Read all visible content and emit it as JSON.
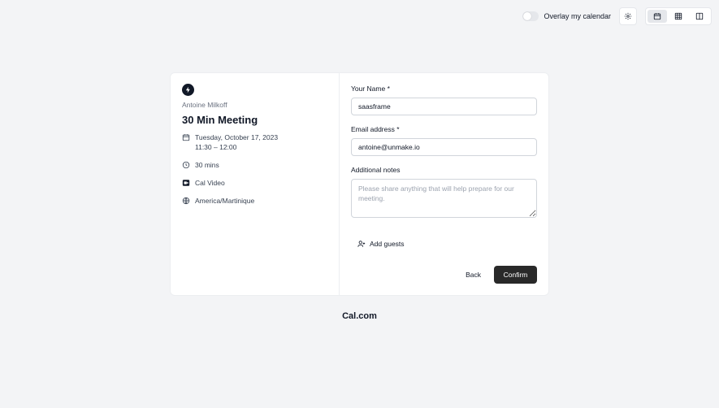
{
  "topbar": {
    "overlay_label": "Overlay my calendar",
    "overlay_on": false,
    "icons": {
      "settings": "gear-icon",
      "month_view": "calendar-icon",
      "week_view": "grid-icon",
      "column_view": "columns-icon"
    }
  },
  "event": {
    "host": "Antoine Milkoff",
    "title": "30 Min Meeting",
    "date": "Tuesday, October 17, 2023",
    "time": "11:30 – 12:00",
    "duration": "30 mins",
    "location": "Cal Video",
    "timezone": "America/Martinique"
  },
  "form": {
    "name_label": "Your Name *",
    "name_value": "saasframe",
    "email_label": "Email address *",
    "email_value": "antoine@unmake.io",
    "notes_label": "Additional notes",
    "notes_placeholder": "Please share anything that will help prepare for our meeting.",
    "add_guests": "Add guests",
    "back": "Back",
    "confirm": "Confirm"
  },
  "brand": "Cal.com",
  "colors": {
    "primary": "#292929",
    "background": "#f3f4f6"
  }
}
